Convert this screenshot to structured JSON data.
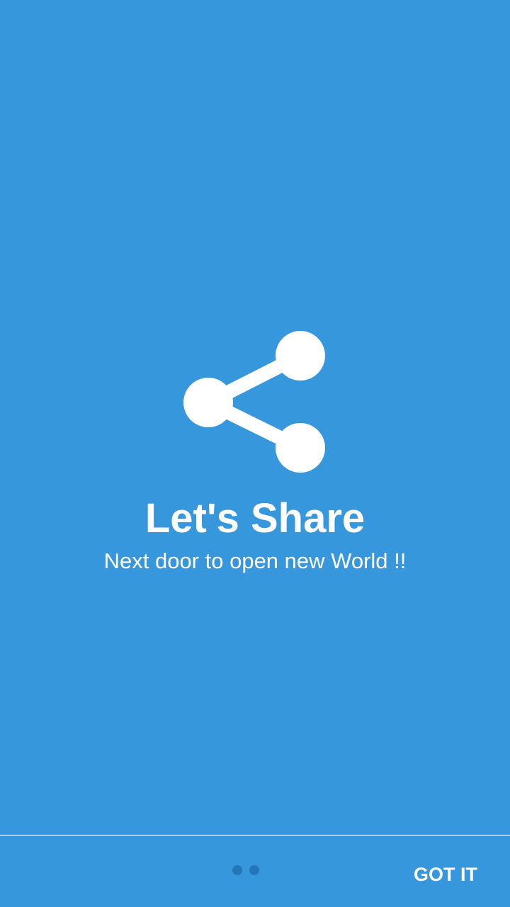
{
  "intro": {
    "title": "Let's Share",
    "subtitle": "Next door to open new World !!",
    "icon": "share-icon"
  },
  "footer": {
    "page_count": 2,
    "active_page": 1,
    "got_it_label": "GOT IT"
  },
  "colors": {
    "background": "#3797dc",
    "foreground": "#ffffff",
    "pager_dot": "#2476b8"
  }
}
